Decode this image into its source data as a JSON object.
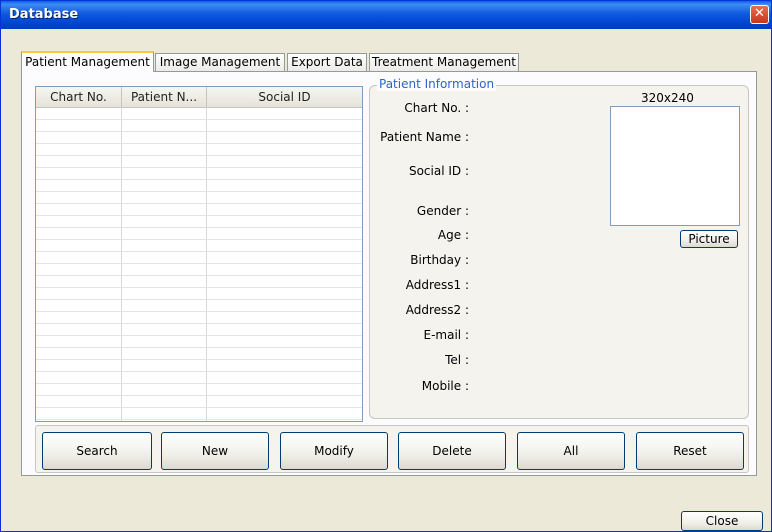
{
  "window": {
    "title": "Database",
    "close_glyph": "✕"
  },
  "tabs": [
    {
      "label": "Patient Management",
      "active": true
    },
    {
      "label": "Image Management",
      "active": false
    },
    {
      "label": "Export Data",
      "active": false
    },
    {
      "label": "Treatment Management",
      "active": false
    }
  ],
  "grid": {
    "columns": [
      "Chart No.",
      "Patient N...",
      "Social ID"
    ],
    "rows": []
  },
  "patient_info": {
    "group_title": "Patient Information",
    "labels": {
      "chart_no": "Chart No. :",
      "patient_name": "Patient Name :",
      "social_id": "Social ID :",
      "gender": "Gender :",
      "age": "Age :",
      "birthday": "Birthday :",
      "address1": "Address1 :",
      "address2": "Address2 :",
      "email": "E-mail :",
      "tel": "Tel :",
      "mobile": "Mobile :"
    },
    "photo_size": "320x240",
    "picture_button": "Picture"
  },
  "actions": {
    "search": "Search",
    "new": "New",
    "modify": "Modify",
    "delete": "Delete",
    "all": "All",
    "reset": "Reset"
  },
  "footer": {
    "close": "Close"
  },
  "colors": {
    "title_bar": "#0054e3",
    "group_title": "#2e63c8",
    "active_tab_accent": "#ffc83c"
  }
}
